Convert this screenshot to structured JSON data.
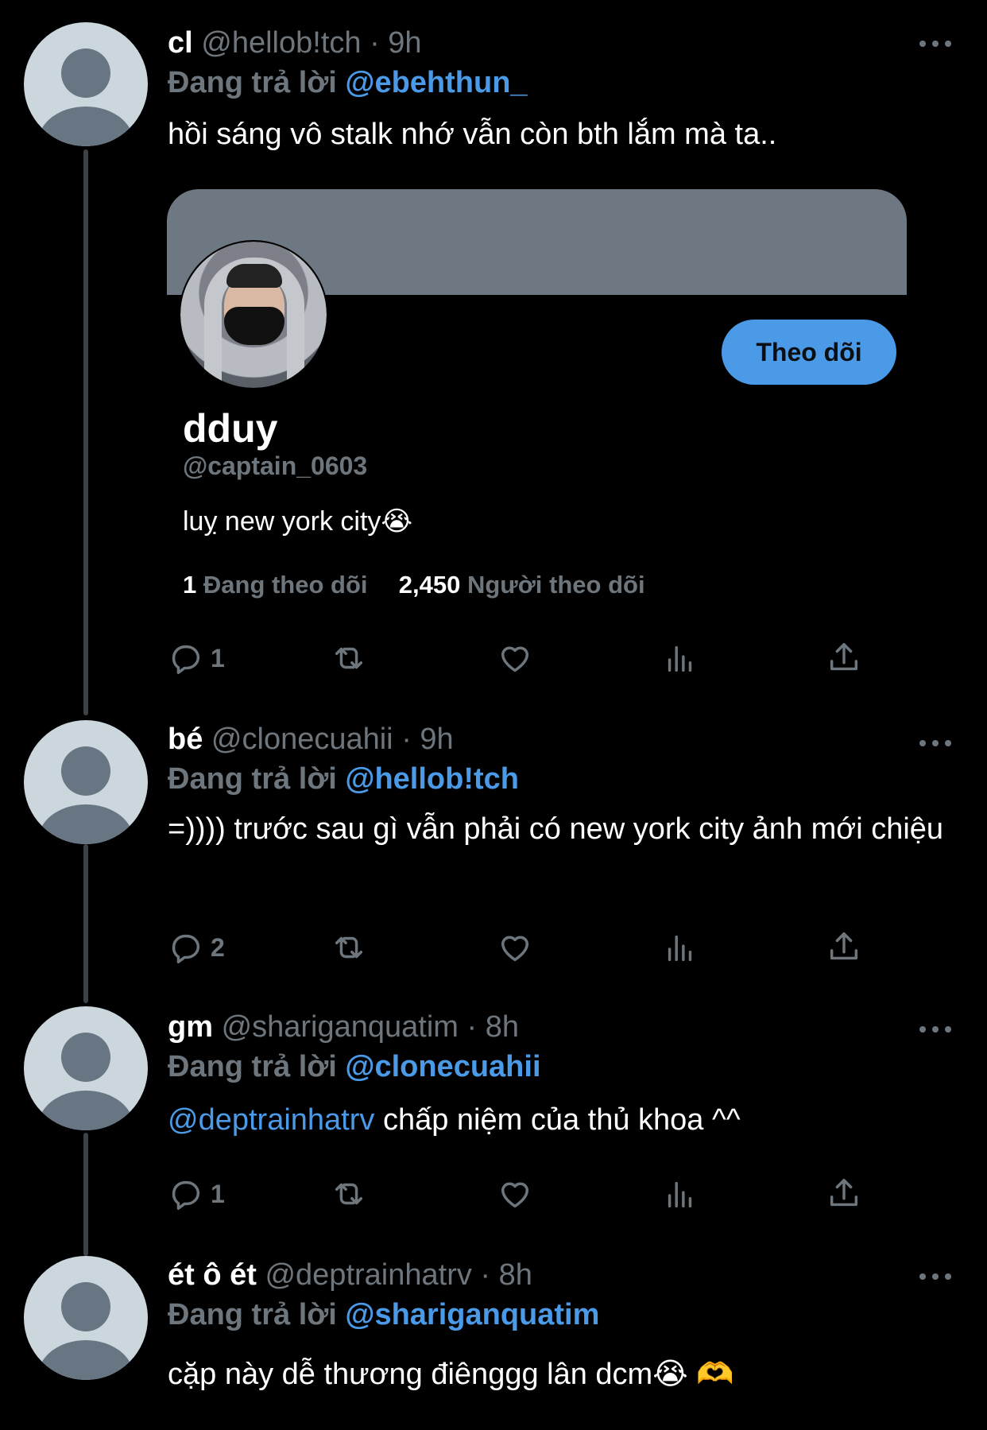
{
  "tweets": [
    {
      "display_name": "cl",
      "handle": "@hellob!tch",
      "time": "9h",
      "replying_label": "Đang trả lời",
      "replying_to": "@ebehthun_",
      "text": "hồi sáng vô stalk nhớ vẫn còn bth lắm mà ta..",
      "reply_count": "1"
    },
    {
      "display_name": "bé",
      "handle": "@clonecuahii",
      "time": "9h",
      "replying_label": "Đang trả lời",
      "replying_to": "@hellob!tch",
      "text": "=)))) trước sau gì vẫn phải có new york city ảnh mới chiệu",
      "reply_count": "2"
    },
    {
      "display_name": "gm",
      "handle": "@shariganquatim",
      "time": "8h",
      "replying_label": "Đang trả lời",
      "replying_to": "@clonecuahii",
      "text_mention": "@deptrainhatrv",
      "text": " chấp niệm của thủ khoa ^^",
      "reply_count": "1"
    },
    {
      "display_name": "ét ô ét",
      "handle": "@deptrainhatrv",
      "time": "8h",
      "replying_label": "Đang trả lời",
      "replying_to": "@shariganquatim",
      "text": "cặp này dễ thương điênggg lân dcm😭 🫶"
    }
  ],
  "separator": "·",
  "profile_card": {
    "name": "dduy",
    "handle": "@captain_0603",
    "bio": "luỵ new york city😭",
    "following_count": "1",
    "following_label": "Đang theo dõi",
    "followers_count": "2,450",
    "followers_label": "Người theo dõi",
    "follow_button": "Theo dõi"
  },
  "icons": {
    "reply": "reply-icon",
    "retweet": "retweet-icon",
    "like": "heart-icon",
    "analytics": "analytics-icon",
    "share": "share-icon",
    "more": "more-icon"
  },
  "colors": {
    "background": "#000000",
    "accent": "#4a9ae8",
    "secondary_text": "#6e767d"
  }
}
